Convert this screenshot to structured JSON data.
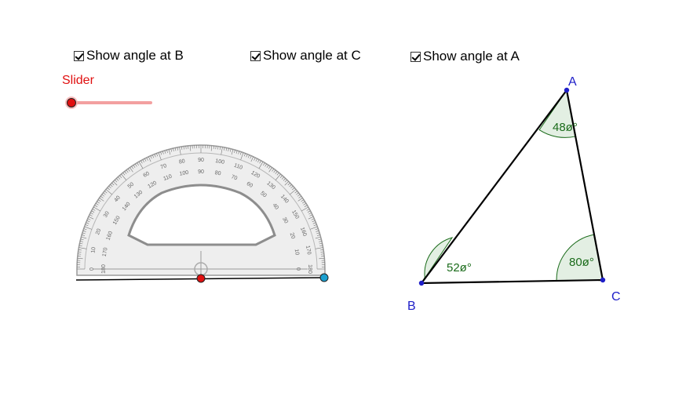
{
  "checkboxes": {
    "angle_b": {
      "label": "Show angle at B",
      "checked": true
    },
    "angle_c": {
      "label": "Show angle at C",
      "checked": true
    },
    "angle_a": {
      "label": "Show angle at A",
      "checked": true
    }
  },
  "slider": {
    "label": "Slider",
    "value": 0.0,
    "color": "#e01010"
  },
  "triangle": {
    "vertex_a": "A",
    "vertex_b": "B",
    "vertex_c": "C",
    "angle_a": "48ø°",
    "angle_b": "52ø°",
    "angle_c": "80ø°",
    "angle_color": "#1a6b1a",
    "point_color": "#1e1ec8"
  },
  "protractor": {
    "outer_numbers": [
      "0",
      "10",
      "20",
      "30",
      "40",
      "50",
      "60",
      "70",
      "80",
      "90",
      "100",
      "110",
      "120",
      "130",
      "140",
      "150",
      "160",
      "170",
      "180"
    ],
    "inner_numbers": [
      "180",
      "170",
      "160",
      "150",
      "140",
      "130",
      "120",
      "110",
      "100",
      "90",
      "80",
      "70",
      "60",
      "50",
      "40",
      "30",
      "20",
      "10",
      "0"
    ],
    "left_point_color": "#e01010",
    "right_point_color": "#1b9fcf"
  }
}
